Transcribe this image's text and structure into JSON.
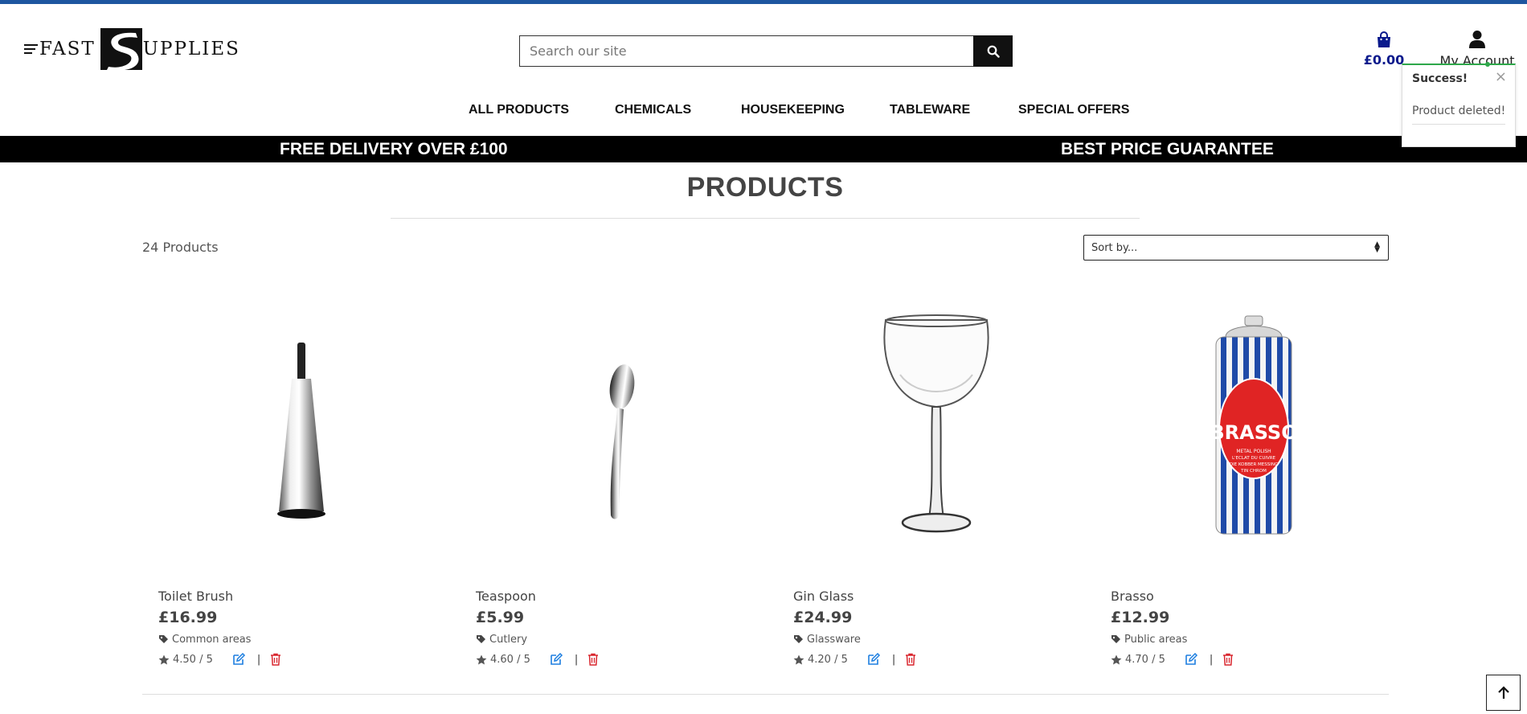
{
  "header": {
    "logo_left": "FAST",
    "logo_right": "UPPLIES",
    "search_placeholder": "Search our site",
    "cart_total": "£0.00",
    "account_label": "My Account"
  },
  "nav": {
    "items": [
      "ALL PRODUCTS",
      "CHEMICALS",
      "HOUSEKEEPING",
      "TABLEWARE",
      "SPECIAL OFFERS"
    ]
  },
  "banner": {
    "left": "FREE DELIVERY OVER £100",
    "right": "BEST PRICE GUARANTEE"
  },
  "page": {
    "title": "PRODUCTS",
    "count": "24 Products",
    "sort_label": "Sort by..."
  },
  "products": [
    {
      "name": "Toilet Brush",
      "price": "£16.99",
      "category": "Common areas",
      "rating": "4.50 / 5"
    },
    {
      "name": "Teaspoon",
      "price": "£5.99",
      "category": "Cutlery",
      "rating": "4.60 / 5"
    },
    {
      "name": "Gin Glass",
      "price": "£24.99",
      "category": "Glassware",
      "rating": "4.20 / 5"
    },
    {
      "name": "Brasso",
      "price": "£12.99",
      "category": "Public areas",
      "rating": "4.70 / 5"
    }
  ],
  "product_image_text": {
    "brand": "BRASSO",
    "sub1": "METAL POLISH",
    "sub2": "L'ECLAT DU CUIVRE",
    "sub3": "DIE KOBBER MESSING",
    "sub4": "TIN CHROM"
  },
  "toast": {
    "title": "Success!",
    "message": "Product deleted!",
    "close": "×"
  },
  "icons": {
    "search": "search-icon",
    "cart": "shopping-bag-icon",
    "account": "user-icon",
    "tag": "tag-icon",
    "star": "star-icon",
    "edit": "edit-icon",
    "delete": "trash-icon",
    "back_to_top": "arrow-up-icon"
  },
  "colors": {
    "accent_blue": "#1e56a0",
    "cart_blue": "#0a1a8c",
    "edit_blue": "#1e7fe0",
    "delete_red": "#d9262e",
    "success_green": "#2ea84a"
  }
}
